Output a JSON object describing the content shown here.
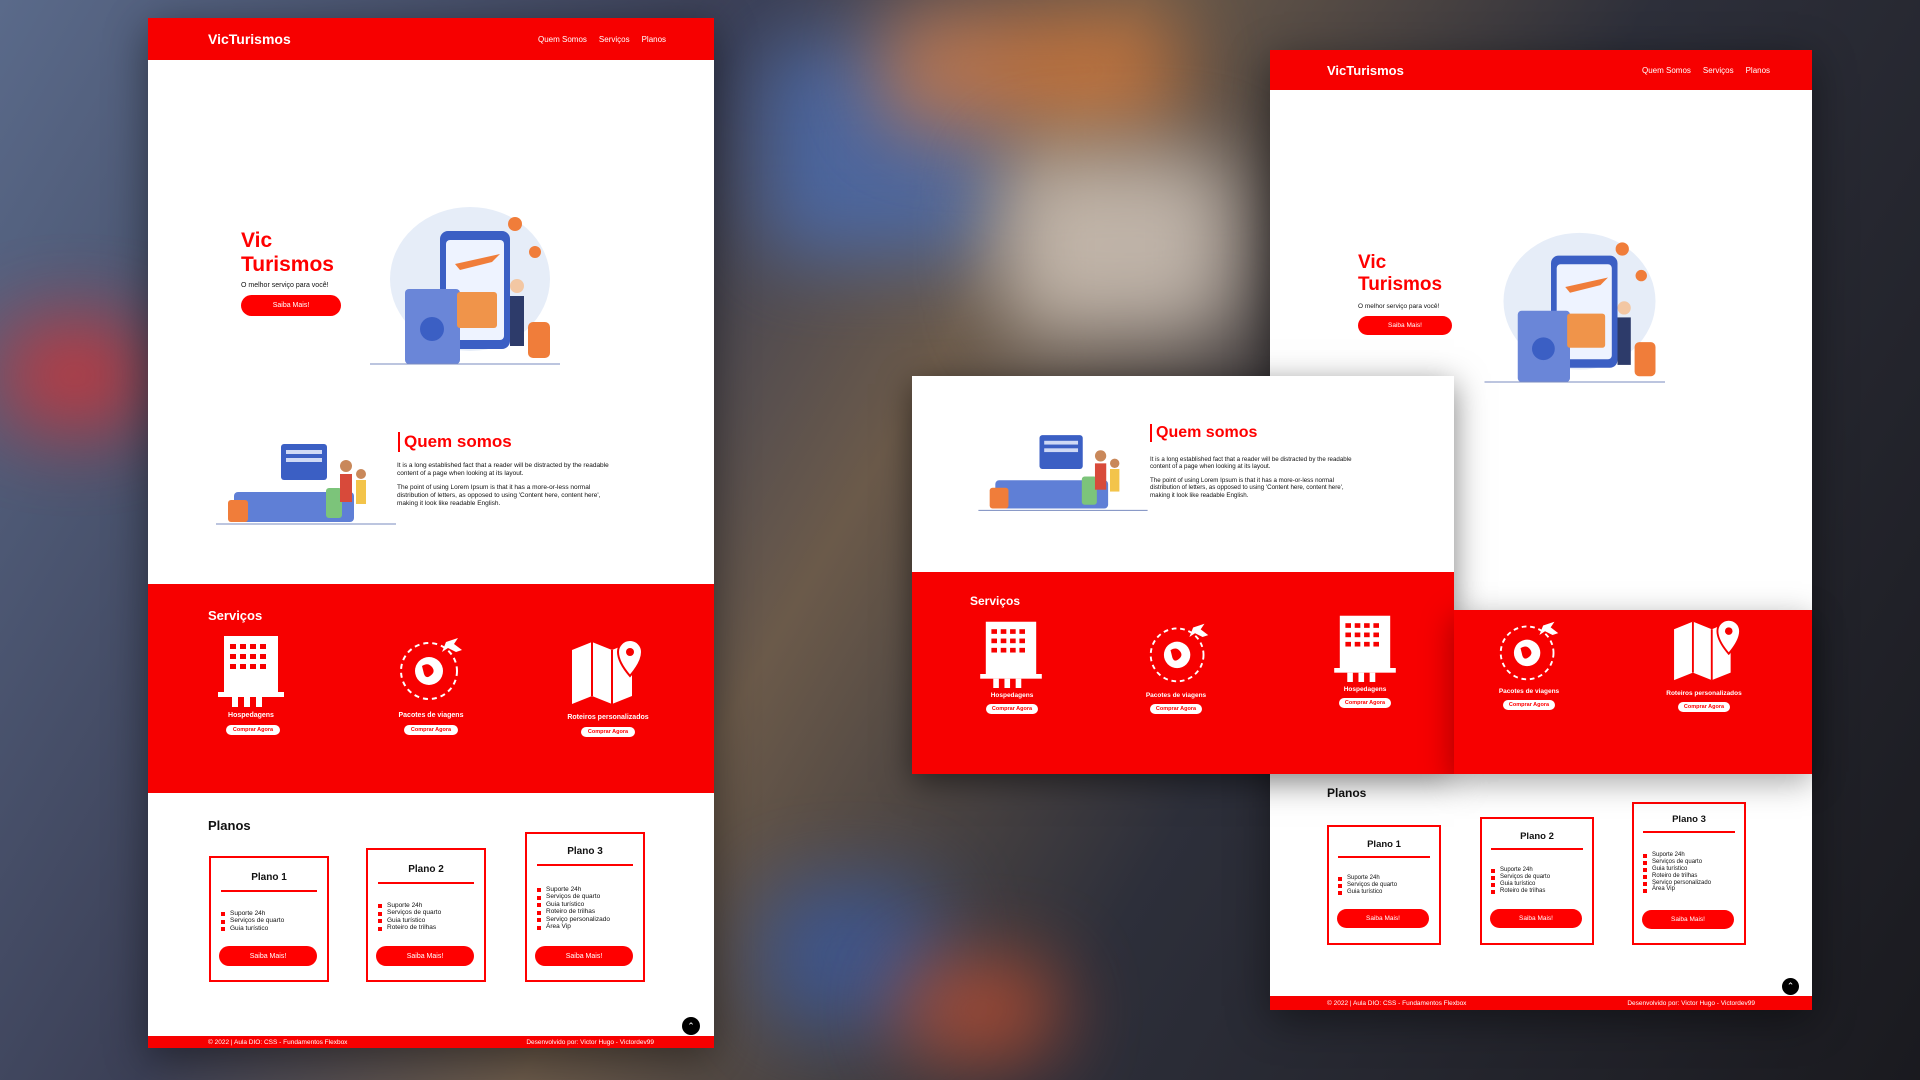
{
  "brand": "VicTurismos",
  "nav": [
    "Quem Somos",
    "Serviços",
    "Planos"
  ],
  "hero": {
    "title_line1": "Vic",
    "title_line2": "Turismos",
    "subtitle": "O melhor serviço para você!",
    "button": "Saiba Mais!"
  },
  "about": {
    "title": "Quem somos",
    "p1": "It is a long established fact that a reader will be distracted by the readable content of a page when looking at its layout.",
    "p2": "The point of using Lorem Ipsum is that it has a more-or-less normal distribution of letters, as opposed to using 'Content here, content here', making it look like readable English."
  },
  "services": {
    "title": "Serviços",
    "items": [
      {
        "label": "Hospedagens",
        "button": "Comprar Agora",
        "icon": "hotel-icon"
      },
      {
        "label": "Pacotes de viagens",
        "button": "Comprar Agora",
        "icon": "globe-plane-icon"
      },
      {
        "label": "Roteiros personalizados",
        "button": "Comprar Agora",
        "icon": "map-icon"
      }
    ]
  },
  "plans": {
    "title": "Planos",
    "items": [
      {
        "name": "Plano 1",
        "features": [
          "Suporte 24h",
          "Serviços de quarto",
          "Guia turístico"
        ],
        "button": "Saiba Mais!"
      },
      {
        "name": "Plano 2",
        "features": [
          "Suporte 24h",
          "Serviços de quarto",
          "Guia turístico",
          "Roteiro de trilhas"
        ],
        "button": "Saiba Mais!"
      },
      {
        "name": "Plano 3",
        "features": [
          "Suporte 24h",
          "Serviços de quarto",
          "Guia turístico",
          "Roteiro de trilhas",
          "Serviço personalizado",
          "Área Vip"
        ],
        "button": "Saiba Mais!"
      }
    ]
  },
  "footer": {
    "left": "© 2022 | Aula DIO: CSS - Fundamentos Flexbox",
    "right": "Desenvolvido por: Victor Hugo - Victordev99"
  },
  "colors": {
    "primary": "#f70000",
    "text": "#111111",
    "background": "#ffffff"
  }
}
